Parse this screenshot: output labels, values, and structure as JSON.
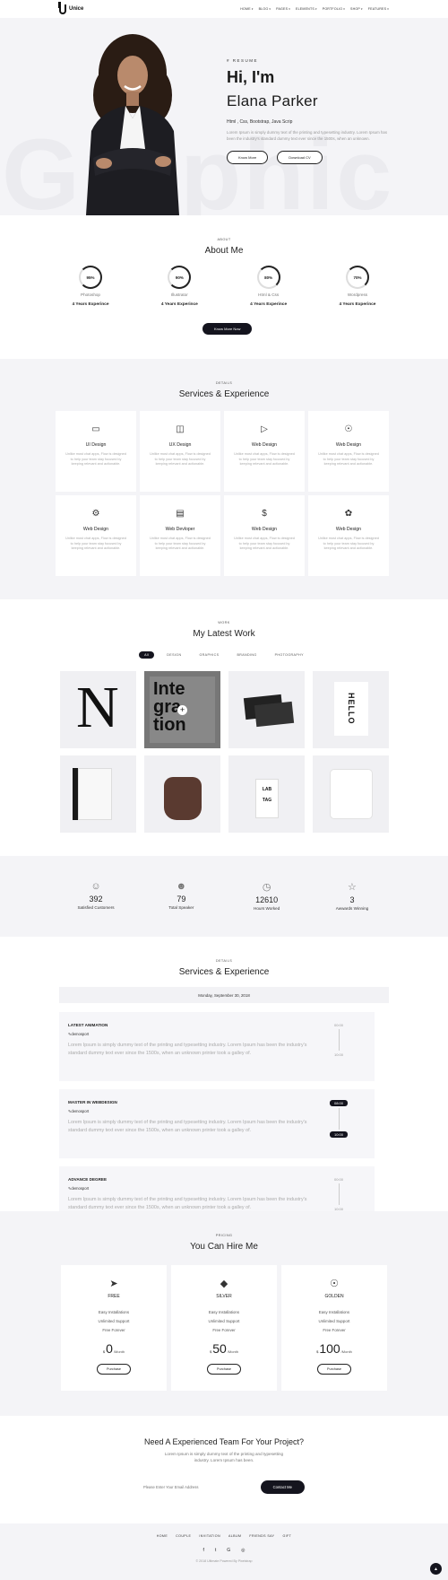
{
  "header": {
    "logo_text": "Unice",
    "nav": [
      "HOME",
      "BLOG",
      "PAGES",
      "ELEMENTS",
      "PORTFOLIO",
      "SHOP",
      "FEATURES"
    ]
  },
  "hero": {
    "kicker": "# RESUME",
    "title": "Hi, I'm",
    "name": "Elana Parker",
    "skills": "Html , Css, Bootstrap, Java Scrip",
    "description": "Lorem Ipsum is simply dummy text of the printing and typesetting industry. Lorem Ipsum has been the industry's standard dummy text ever since the 1500s, when an unknown.",
    "btn_more": "Know More",
    "btn_cv": "Download CV",
    "bg_text": "Graphic"
  },
  "about": {
    "kicker": "ABOUT",
    "title": "About Me",
    "skills": [
      {
        "percent": "95%",
        "name": "Photoshop",
        "exp": "4 Years Experince"
      },
      {
        "percent": "90%",
        "name": "Illustrator",
        "exp": "4 Years Experince"
      },
      {
        "percent": "80%",
        "name": "Html & Css",
        "exp": "4 Years Experince"
      },
      {
        "percent": "70%",
        "name": "Wordpress",
        "exp": "4 Years Experince"
      }
    ],
    "btn": "Know More Now"
  },
  "services": {
    "kicker": "DETAILS",
    "title": "Services & Experience",
    "items": [
      {
        "icon": "monitor-icon",
        "title": "UI Design",
        "desc": "Unlike most chat apps, Flow is designed to help your team stay focused by keeping relevant and actionable."
      },
      {
        "icon": "layers-icon",
        "title": "UX Design",
        "desc": "Unlike most chat apps, Flow is designed to help your team stay focused by keeping relevant and actionable."
      },
      {
        "icon": "megaphone-icon",
        "title": "Web Design",
        "desc": "Unlike most chat apps, Flow is designed to help your team stay focused by keeping relevant and actionable."
      },
      {
        "icon": "award-icon",
        "title": "Web Design",
        "desc": "Unlike most chat apps, Flow is designed to help your team stay focused by keeping relevant and actionable."
      },
      {
        "icon": "gear-icon",
        "title": "Web Design",
        "desc": "Unlike most chat apps, Flow is designed to help your team stay focused by keeping relevant and actionable."
      },
      {
        "icon": "book-icon",
        "title": "Web Devloper",
        "desc": "Unlike most chat apps, Flow is designed to help your team stay focused by keeping relevant and actionable."
      },
      {
        "icon": "dollar-icon",
        "title": "Web Design",
        "desc": "Unlike most chat apps, Flow is designed to help your team stay focused by keeping relevant and actionable."
      },
      {
        "icon": "leaf-icon",
        "title": "Web Design",
        "desc": "Unlike most chat apps, Flow is designed to help your team stay focused by keeping relevant and actionable."
      }
    ]
  },
  "work": {
    "kicker": "WORK",
    "title": "My Latest Work",
    "filters": [
      "All",
      "DESIGN",
      "GRAPHICS",
      "BRANDING",
      "PHOTOGRAPHY"
    ],
    "tiles": {
      "n_letter": "N",
      "integration": [
        "Inte",
        "gra",
        "tion"
      ],
      "hello": "HELLO",
      "tag": [
        "LAB",
        "TAG"
      ]
    }
  },
  "counters": [
    {
      "icon": "smile-icon",
      "value": "392",
      "label": "Satisfied Customers"
    },
    {
      "icon": "users-icon",
      "value": "79",
      "label": "Total Speaker"
    },
    {
      "icon": "clock-icon",
      "value": "12610",
      "label": "Hours Worked"
    },
    {
      "icon": "trophy-icon",
      "value": "3",
      "label": "Awwards Winning"
    }
  ],
  "timeline": {
    "kicker": "DETAILS",
    "title": "Services & Experience",
    "date": "Monday, September 30, 2018",
    "items": [
      {
        "title": "LATEST ANIMATION",
        "author": "demosport",
        "desc": "Lorem Ipsum is simply dummy text of the printing and typesetting industry. Lorem Ipsum has been the industry's standard dummy text ever since the 1500s, when an unknown printer took a galley of.",
        "t1": "00:00",
        "t2": "10:00"
      },
      {
        "title": "MASTER IN WEBDESIGN",
        "author": "demosport",
        "desc": "Lorem Ipsum is simply dummy text of the printing and typesetting industry. Lorem Ipsum has been the industry's standard dummy text ever since the 1500s, when an unknown printer took a galley of.",
        "t1": "08:00",
        "t2": "10:00"
      },
      {
        "title": "ADVANCE DEGREE",
        "author": "demosport",
        "desc": "Lorem Ipsum is simply dummy text of the printing and typesetting industry. Lorem Ipsum has been the industry's standard dummy text ever since the 1500s, when an unknown printer took a galley of.",
        "t1": "00:00",
        "t2": "10:00"
      }
    ]
  },
  "pricing": {
    "kicker": "PRICING",
    "title": "You Can Hire Me",
    "plans": [
      {
        "icon": "rocket-icon",
        "name": "FREE",
        "features": [
          "Easy Installations",
          "Unlimited Support",
          "Free Forever"
        ],
        "currency": "$",
        "amount": "0",
        "per": "/Month",
        "btn": "Purchase"
      },
      {
        "icon": "diamond-icon",
        "name": "SILVER",
        "features": [
          "Easy Installations",
          "Unlimited Support",
          "Free Forever"
        ],
        "currency": "$",
        "amount": "50",
        "per": "/Month",
        "btn": "Purchase"
      },
      {
        "icon": "globe-icon",
        "name": "GOLDEN",
        "features": [
          "Easy Installations",
          "Unlimited Support",
          "Free Forever"
        ],
        "currency": "$",
        "amount": "100",
        "per": "/Month",
        "btn": "Purchase"
      }
    ]
  },
  "cta": {
    "title": "Need A Experienced Team For Your Project?",
    "desc": "Lorem Ipsum is simply dummy text of the printing and typesetting industry. Lorem Ipsum has been.",
    "placeholder": "Please Enter Your Email Address",
    "btn": "Contact Me"
  },
  "footer": {
    "links": [
      "HOME",
      "COUPLE",
      "INVITATION",
      "ALBUM",
      "FRIENDS SAY",
      "GIFT"
    ],
    "socials": [
      "f",
      "t",
      "G",
      "◎"
    ],
    "copyright": "© 2018 Ultimate Powered By Pixelstrap",
    "to_top": "▲"
  },
  "colors": {
    "dark": "#14141e",
    "section_bg": "#f4f4f7"
  }
}
